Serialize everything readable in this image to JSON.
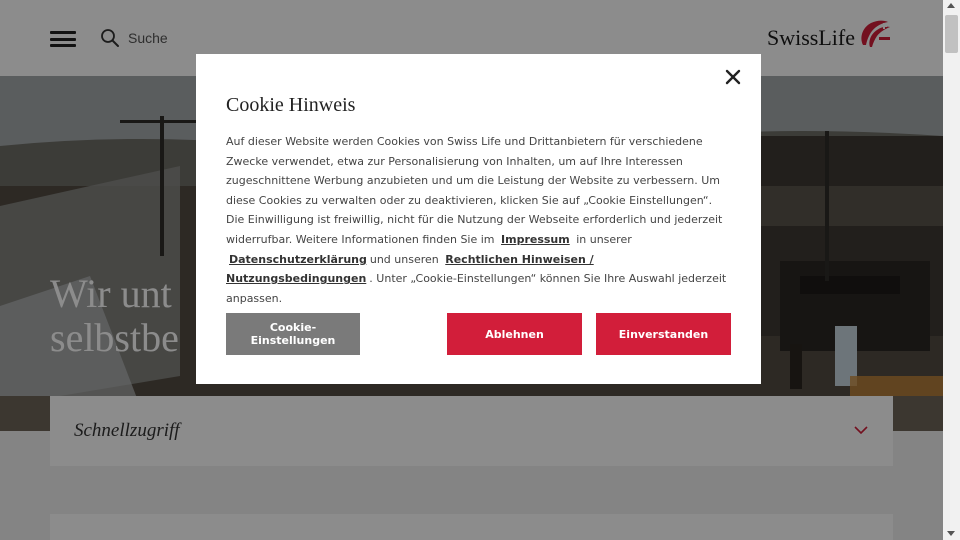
{
  "header": {
    "search_label": "Suche",
    "logo_text": "SwissLife",
    "icons": {
      "menu": "hamburger-menu-icon",
      "search": "search-icon",
      "logo": "swisslife-logo-mark"
    }
  },
  "hero": {
    "title_line1": "Wir unt",
    "title_line2": "selbstbe"
  },
  "quick_access": {
    "label": "Schnellzugriff",
    "icon": "chevron-down-icon"
  },
  "cookie_modal": {
    "title": "Cookie Hinweis",
    "body_part1": "Auf dieser Website werden Cookies von Swiss Life und Drittanbietern für verschiedene Zwecke verwendet, etwa zur Personalisierung von Inhalten, um auf Ihre Interessen zugeschnittene Werbung anzubieten und um die Leistung der Website zu verbessern. Um diese Cookies zu verwalten oder zu deaktivieren, klicken Sie auf „Cookie Einstellungen“. Die Einwilligung ist freiwillig, nicht für die Nutzung der Webseite erforderlich und jederzeit widerrufbar. Weitere Informationen finden Sie im",
    "link_impressum": "Impressum",
    "body_part2": "in unserer",
    "link_datenschutz": "Datenschutzerklärung",
    "body_part3": "und unseren",
    "link_rechtliche": "Rechtlichen Hinweisen / Nutzungsbedingungen",
    "body_part4": ". Unter „Cookie-Einstellungen“ können Sie Ihre Auswahl jederzeit anpassen.",
    "settings_button": "Cookie-Einstellungen",
    "decline_button": "Ablehnen",
    "accept_button": "Einverstanden",
    "close_icon": "close-icon"
  },
  "colors": {
    "brand_red": "#d21e3a",
    "settings_gray": "#7a7a7a",
    "overlay": "rgba(0,0,0,0.45)"
  }
}
